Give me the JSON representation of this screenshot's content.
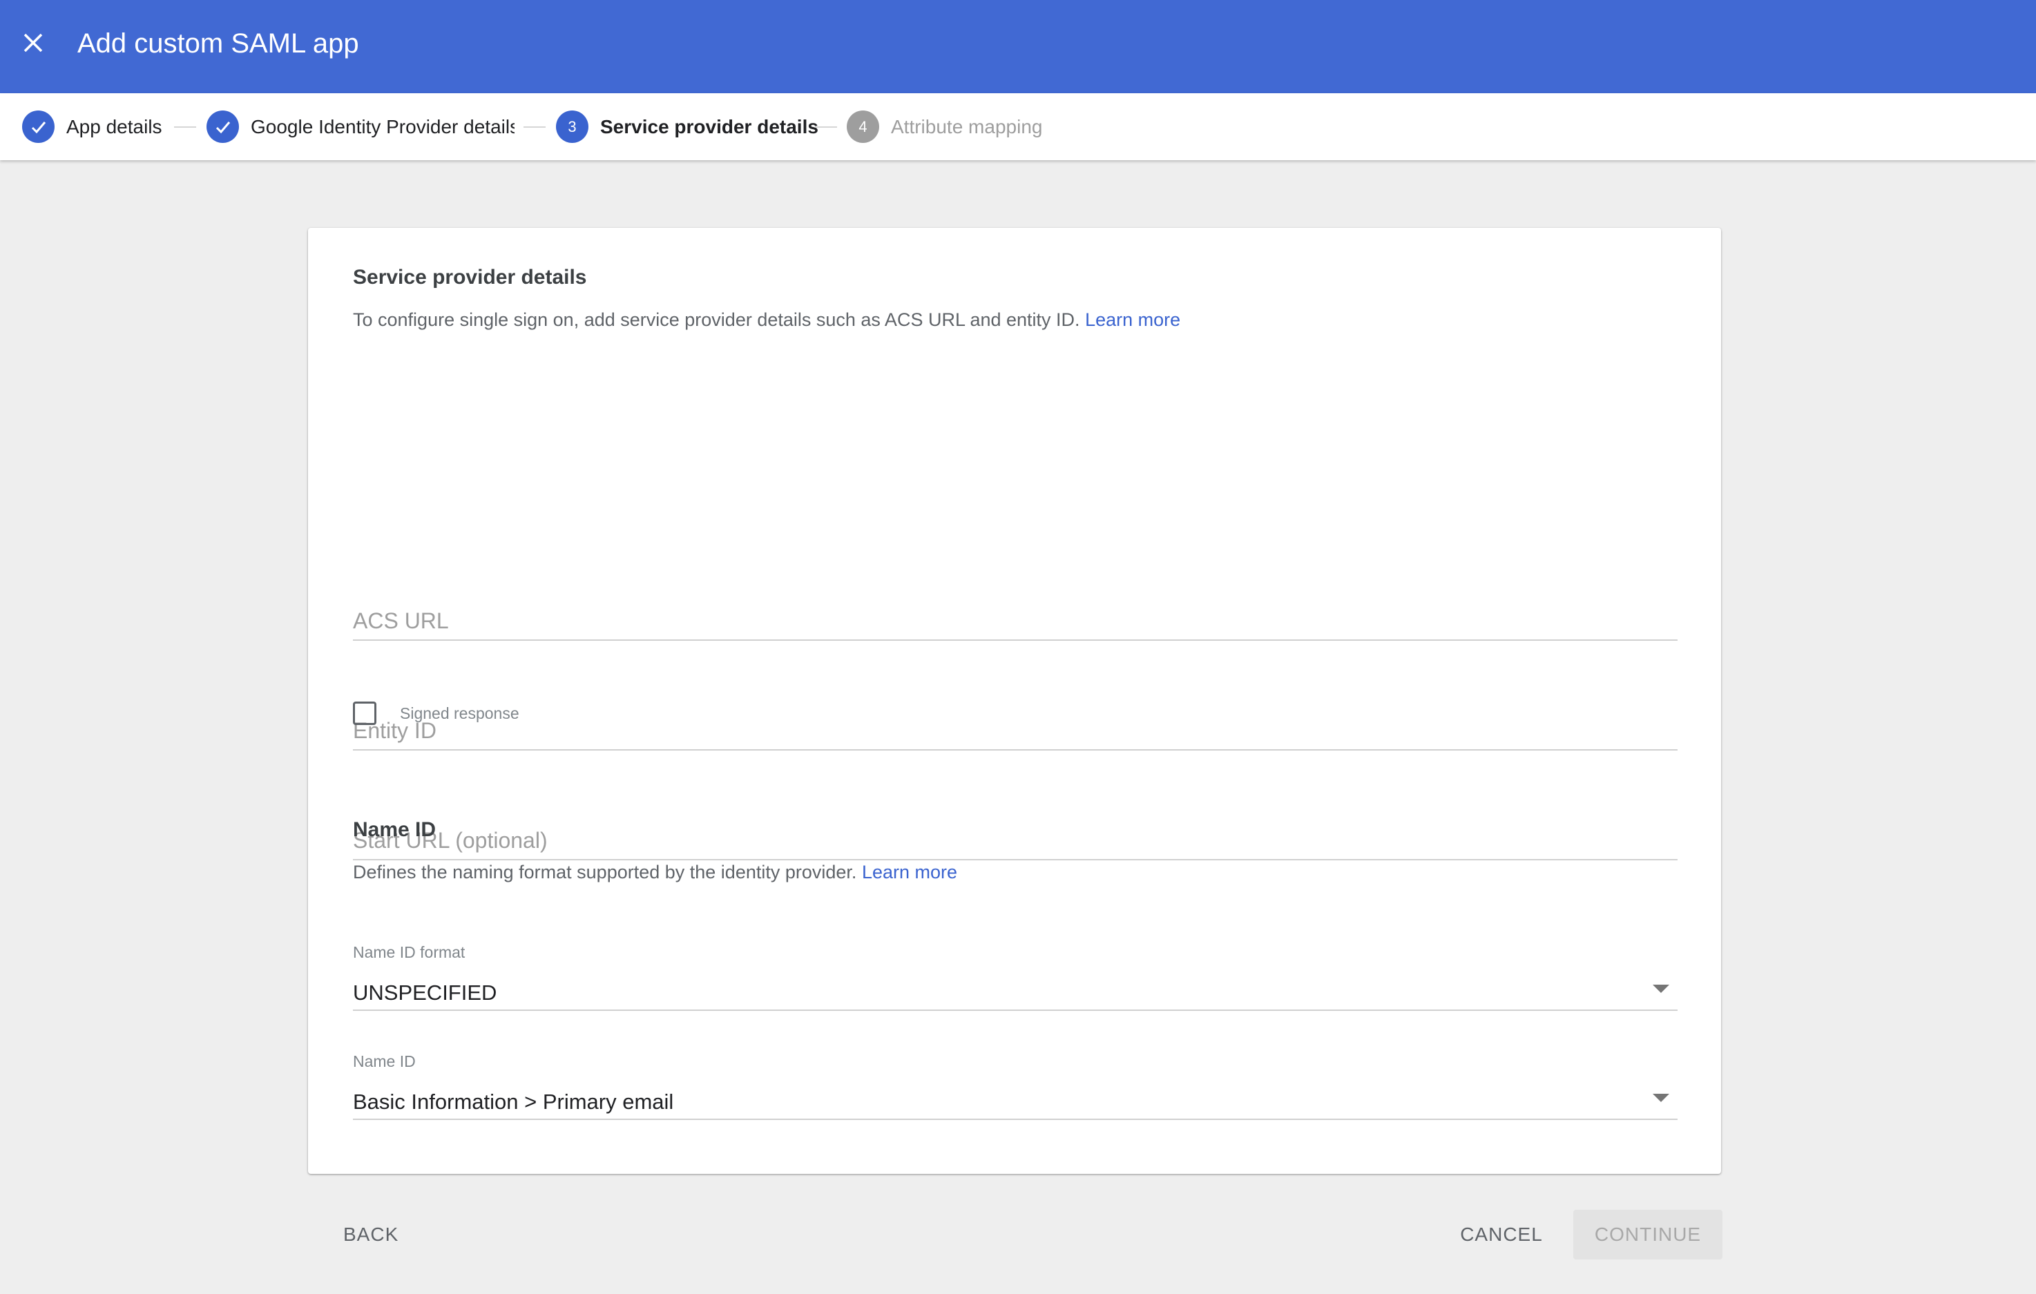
{
  "header": {
    "title": "Add custom SAML app",
    "close_icon": "close-icon",
    "background_color": "#4169d3"
  },
  "stepper": {
    "steps": [
      {
        "label": "App details",
        "status": "done",
        "icon": "check-icon"
      },
      {
        "label": "Google Identity Provider details",
        "status": "done",
        "icon": "check-icon"
      },
      {
        "label": "Service provider details",
        "status": "active",
        "number": "3"
      },
      {
        "label": "Attribute mapping",
        "status": "pending",
        "number": "4"
      }
    ]
  },
  "service_provider": {
    "title": "Service provider details",
    "description": "To configure single sign on, add service provider details such as ACS URL and entity ID.",
    "learn_more": "Learn more",
    "acs_url": {
      "placeholder": "ACS URL",
      "value": ""
    },
    "entity_id": {
      "placeholder": "Entity ID",
      "value": ""
    },
    "start_url": {
      "placeholder": "Start URL (optional)",
      "value": ""
    },
    "signed_response": {
      "label": "Signed response",
      "checked": false
    }
  },
  "name_id": {
    "title": "Name ID",
    "description": "Defines the naming format supported by the identity provider.",
    "learn_more": "Learn more",
    "format": {
      "label": "Name ID format",
      "value": "UNSPECIFIED"
    },
    "name_id_select": {
      "label": "Name ID",
      "value": "Basic Information > Primary email"
    }
  },
  "footer": {
    "back_label": "BACK",
    "cancel_label": "CANCEL",
    "continue_label": "CONTINUE"
  }
}
